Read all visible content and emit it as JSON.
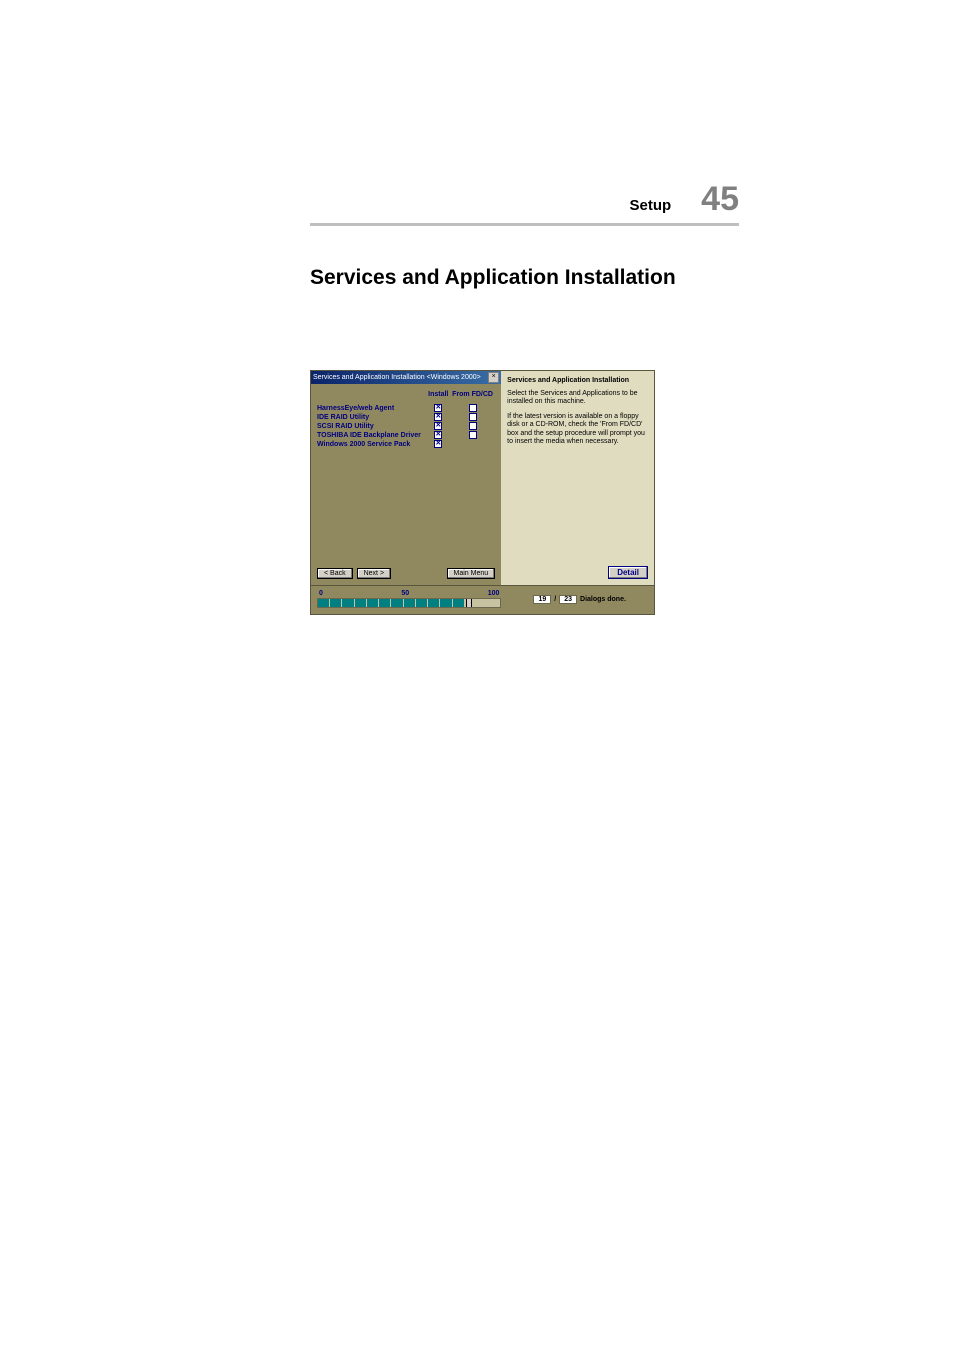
{
  "header": {
    "section": "Setup",
    "page_number": "45"
  },
  "title": "Services and Application Installation",
  "dialog": {
    "titlebar": "Services and Application Installation <Windows 2000>",
    "columns": {
      "name": "",
      "install": "Install",
      "from": "From FD/CD"
    },
    "rows": [
      {
        "name": "HarnessEye/web Agent",
        "install": true,
        "from": false
      },
      {
        "name": "IDE RAID Utility",
        "install": true,
        "from": false
      },
      {
        "name": "SCSI RAID Utility",
        "install": true,
        "from": false
      },
      {
        "name": "TOSHIBA IDE Backplane Driver",
        "install": true,
        "from": false
      },
      {
        "name": "Windows 2000 Service Pack",
        "install": true,
        "from": null
      }
    ],
    "buttons": {
      "back": "< Back",
      "next": "Next >",
      "main_menu": "Main Menu"
    }
  },
  "info_panel": {
    "title": "Services and Application Installation",
    "p1": "Select the Services and Applications to be installed on this machine.",
    "p2": "If the latest version is available on a floppy disk or a CD-ROM, check the 'From FD/CD' box and the setup procedure will prompt you to insert the media when necessary.",
    "detail": "Detail"
  },
  "progress": {
    "scale": {
      "min": "0",
      "mid": "50",
      "max": "100"
    },
    "filled_segments": 12,
    "total_segments": 15,
    "marker_percent": 83
  },
  "status": {
    "current": "19",
    "sep": "/",
    "total": "23",
    "label": "Dialogs done."
  }
}
